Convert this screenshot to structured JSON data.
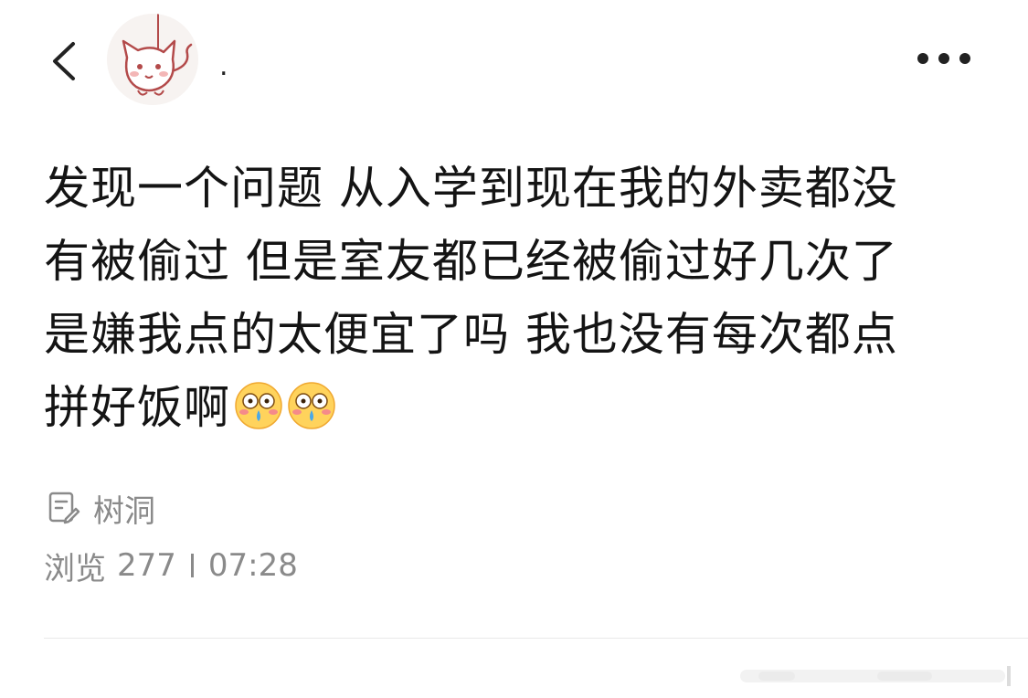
{
  "header": {
    "username": "."
  },
  "post": {
    "lines": [
      "发现一个问题 从入学到现在我的外卖都没",
      "有被偷过 但是室友都已经被偷过好几次了",
      "是嫌我点的太便宜了吗 我也没有每次都点",
      "拼好饭啊"
    ],
    "emojis": [
      "flushed-face-icon",
      "flushed-face-icon"
    ]
  },
  "topic": {
    "label": "树洞",
    "icon": "note-edit-icon"
  },
  "meta": {
    "views_label": "浏览",
    "views_count": "277",
    "time": "07:28"
  },
  "colors": {
    "text": "#141414",
    "muted": "#8a8a8a",
    "divider": "#e8e8e8"
  }
}
